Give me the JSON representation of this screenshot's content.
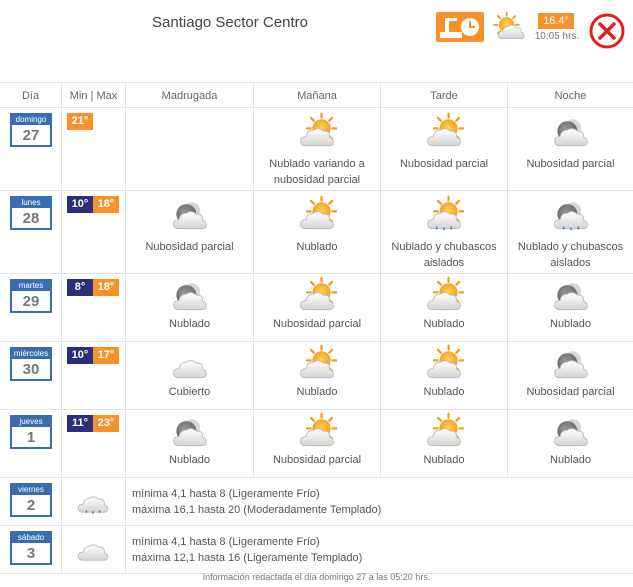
{
  "header": {
    "place": "Santiago Sector Centro",
    "current_temp": "16.4°",
    "time": "10:05 hrs.",
    "station_icon": "weather-station-icon",
    "current_icon": "partly-cloudy-icon",
    "close_icon": "close-icon"
  },
  "columns": {
    "day": "Día",
    "minmax": "Min | Max",
    "p1": "Madrugada",
    "p2": "Mañana",
    "p3": "Tarde",
    "p4": "Noche"
  },
  "days": [
    {
      "name": "domingo",
      "num": "27",
      "min": "",
      "max": "21°",
      "periods": [
        {
          "icon": "",
          "label": ""
        },
        {
          "icon": "sun-cloud-icon",
          "label": "Nublado variando a nubosidad parcial"
        },
        {
          "icon": "sun-cloud-icon",
          "label": "Nubosidad parcial"
        },
        {
          "icon": "moon-cloud-icon",
          "label": "Nubosidad parcial"
        }
      ]
    },
    {
      "name": "lunes",
      "num": "28",
      "min": "10°",
      "max": "18°",
      "periods": [
        {
          "icon": "moon-cloud-icon",
          "label": "Nubosidad parcial"
        },
        {
          "icon": "sun-cloud-icon",
          "label": "Nublado"
        },
        {
          "icon": "sun-cloud-rain-icon",
          "label": "Nublado y chubascos aislados"
        },
        {
          "icon": "moon-cloud-rain-icon",
          "label": "Nublado y chubascos aislados"
        }
      ]
    },
    {
      "name": "martes",
      "num": "29",
      "min": "8°",
      "max": "18°",
      "periods": [
        {
          "icon": "moon-cloud-icon",
          "label": "Nublado"
        },
        {
          "icon": "sun-cloud-icon",
          "label": "Nubosidad parcial"
        },
        {
          "icon": "sun-cloud-icon",
          "label": "Nublado"
        },
        {
          "icon": "moon-cloud-icon",
          "label": "Nublado"
        }
      ]
    },
    {
      "name": "miércoles",
      "num": "30",
      "min": "10°",
      "max": "17°",
      "periods": [
        {
          "icon": "cloud-icon",
          "label": "Cubierto"
        },
        {
          "icon": "sun-cloud-icon",
          "label": "Nublado"
        },
        {
          "icon": "sun-cloud-icon",
          "label": "Nublado"
        },
        {
          "icon": "moon-cloud-icon",
          "label": "Nubosidad parcial"
        }
      ]
    },
    {
      "name": "jueves",
      "num": "1",
      "min": "11°",
      "max": "23°",
      "periods": [
        {
          "icon": "moon-cloud-icon",
          "label": "Nublado"
        },
        {
          "icon": "sun-cloud-icon",
          "label": "Nubosidad parcial"
        },
        {
          "icon": "sun-cloud-icon",
          "label": "Nublado"
        },
        {
          "icon": "moon-cloud-icon",
          "label": "Nublado"
        }
      ]
    },
    {
      "name": "viernes",
      "num": "2",
      "icon": "cloud-rain-icon",
      "min_text": "mínima 4,1 hasta 8 (Ligeramente Frío)",
      "max_text": "máxima 16,1 hasta 20 (Moderadamente Templado)"
    },
    {
      "name": "sábado",
      "num": "3",
      "icon": "cloud-icon",
      "min_text": "mínima 4,1 hasta 8 (Ligeramente Frío)",
      "max_text": "máxima 12,1 hasta 16 (Ligeramente Templado)"
    }
  ],
  "footer": "Información redactada el día domingo 27 a las 05:20 hrs.",
  "colors": {
    "orange": "#f7922a",
    "navy": "#2a2f7a",
    "calendar": "#3a6db0",
    "close": "#e02020"
  }
}
